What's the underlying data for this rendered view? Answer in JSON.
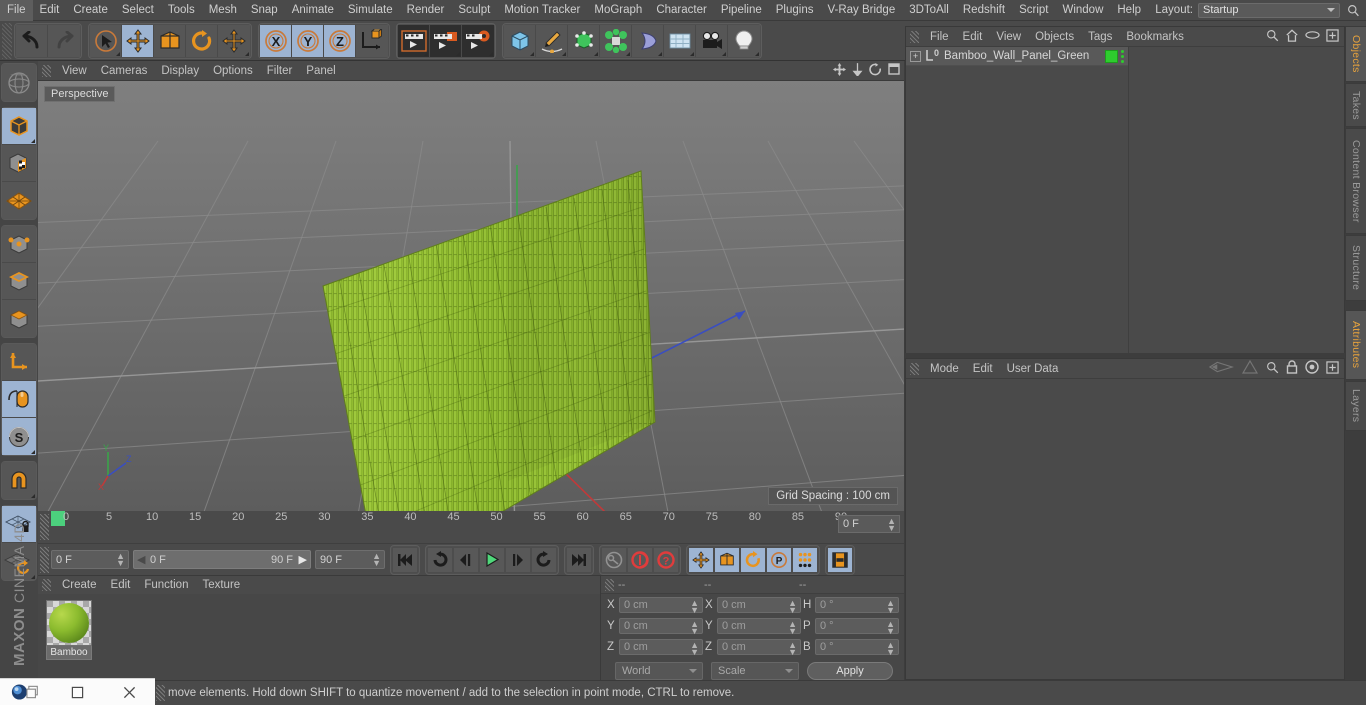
{
  "menubar": {
    "items": [
      "File",
      "Edit",
      "Create",
      "Select",
      "Tools",
      "Mesh",
      "Snap",
      "Animate",
      "Simulate",
      "Render",
      "Sculpt",
      "Motion Tracker",
      "MoGraph",
      "Character",
      "Pipeline",
      "Plugins",
      "V-Ray Bridge",
      "3DToAll",
      "Redshift",
      "Script",
      "Window",
      "Help"
    ],
    "layout_label": "Layout:",
    "layout_value": "Startup",
    "search_icon": "search-icon"
  },
  "toolbar": {
    "groups": [
      {
        "name": "undo-redo",
        "buttons": [
          {
            "name": "undo-button",
            "icon": "undo-arrow-icon",
            "state": "normal"
          },
          {
            "name": "redo-button",
            "icon": "redo-arrow-icon",
            "state": "disabled"
          }
        ]
      },
      {
        "name": "transform-tools",
        "buttons": [
          {
            "name": "select-tool-button",
            "icon": "cursor-select-icon",
            "state": "normal"
          },
          {
            "name": "move-tool-button",
            "icon": "move-arrows-icon",
            "state": "active"
          },
          {
            "name": "scale-tool-button",
            "icon": "scale-box-icon",
            "state": "normal"
          },
          {
            "name": "rotate-tool-button",
            "icon": "rotate-circle-icon",
            "state": "normal"
          },
          {
            "name": "free-move-tool-button",
            "icon": "move-arrows-icon",
            "state": "normal"
          }
        ]
      },
      {
        "name": "axis-locks",
        "buttons": [
          {
            "name": "lock-x-axis-button",
            "icon": "x-axis-icon",
            "state": "active",
            "label": "X"
          },
          {
            "name": "lock-y-axis-button",
            "icon": "y-axis-icon",
            "state": "active",
            "label": "Y"
          },
          {
            "name": "lock-z-axis-button",
            "icon": "z-axis-icon",
            "state": "active",
            "label": "Z"
          },
          {
            "name": "world-object-axis-button",
            "icon": "world-axis-cube-icon",
            "state": "normal"
          }
        ]
      },
      {
        "name": "render-group",
        "buttons": [
          {
            "name": "render-view-button",
            "icon": "render-clapper-icon",
            "state": "dark"
          },
          {
            "name": "render-to-picture-viewer-button",
            "icon": "render-picture-icon",
            "state": "dark"
          },
          {
            "name": "render-settings-button",
            "icon": "render-gear-icon",
            "state": "dark"
          }
        ]
      },
      {
        "name": "create-group",
        "buttons": [
          {
            "name": "add-cube-button",
            "icon": "blue-cube-icon",
            "state": "normal"
          },
          {
            "name": "add-spline-button",
            "icon": "pen-spline-icon",
            "state": "normal"
          },
          {
            "name": "add-generator-button",
            "icon": "green-cube-icon",
            "state": "normal"
          },
          {
            "name": "add-array-button",
            "icon": "green-cluster-icon",
            "state": "normal"
          },
          {
            "name": "add-deformer-button",
            "icon": "bend-deformer-icon",
            "state": "normal"
          },
          {
            "name": "add-environment-button",
            "icon": "floor-grid-icon",
            "state": "normal"
          },
          {
            "name": "add-camera-button",
            "icon": "camera-icon",
            "state": "normal"
          },
          {
            "name": "add-light-button",
            "icon": "light-bulb-icon",
            "state": "normal"
          }
        ]
      }
    ]
  },
  "left_tools": {
    "groups": [
      [
        {
          "name": "world-axis-tool",
          "icon": "globe-axis-icon",
          "state": "disabled"
        }
      ],
      [
        {
          "name": "model-mode-tool",
          "icon": "dark-cube-icon",
          "state": "active"
        },
        {
          "name": "texture-mode-tool",
          "icon": "checker-cube-icon",
          "state": "normal"
        },
        {
          "name": "uv-polygons-tool",
          "icon": "orange-mesh-icon",
          "state": "normal"
        }
      ],
      [
        {
          "name": "points-mode-tool",
          "icon": "points-cube-icon",
          "state": "normal"
        },
        {
          "name": "edges-mode-tool",
          "icon": "edges-cube-icon",
          "state": "normal"
        },
        {
          "name": "polygons-mode-tool",
          "icon": "polygon-cube-icon",
          "state": "normal"
        }
      ],
      [
        {
          "name": "object-axis-tool",
          "icon": "axis-corner-icon",
          "state": "normal"
        },
        {
          "name": "viewport-solo-tool",
          "icon": "mouse-icon",
          "state": "active"
        },
        {
          "name": "enable-axis-tool",
          "icon": "s-sphere-icon",
          "state": "active"
        }
      ],
      [
        {
          "name": "snap-tool",
          "icon": "magnet-icon",
          "state": "normal"
        }
      ],
      [
        {
          "name": "lock-workplane-tool",
          "icon": "grid-lock-icon",
          "state": "active"
        },
        {
          "name": "workplane-rotate-tool",
          "icon": "grid-rotate-icon",
          "state": "normal"
        }
      ]
    ],
    "brand_main": "MAXON",
    "brand_sub": "CINEMA 4D"
  },
  "viewport": {
    "menus": [
      "View",
      "Cameras",
      "Display",
      "Options",
      "Filter",
      "Panel"
    ],
    "label": "Perspective",
    "grid_spacing": "Grid Spacing : 100 cm",
    "axis_labels": {
      "x": "X",
      "y": "Y",
      "z": "Z"
    },
    "icons": [
      "viewport-pan-icon",
      "viewport-dolly-icon",
      "viewport-rotate-icon",
      "viewport-maximize-icon"
    ],
    "object_color": "#8cbb2c",
    "bg_top": "#7b7b7b",
    "bg_bottom": "#5f5f5f"
  },
  "timeline": {
    "ticks": [
      0,
      5,
      10,
      15,
      20,
      25,
      30,
      35,
      40,
      45,
      50,
      55,
      60,
      65,
      70,
      75,
      80,
      85,
      90
    ],
    "min": 0,
    "max": 90,
    "current_frame_field": "0 F"
  },
  "animbar": {
    "current_frame": "0 F",
    "range_start": "0 F",
    "range_end": "90 F",
    "doc_end": "90 F",
    "buttons": [
      {
        "name": "go-to-start-button",
        "icon": "skip-back-icon"
      },
      {
        "name": "play-backwards-button",
        "icon": "rewind-loop-icon"
      },
      {
        "name": "step-back-button",
        "icon": "step-back-icon"
      },
      {
        "name": "play-button",
        "icon": "play-triangle-icon"
      },
      {
        "name": "step-forward-button",
        "icon": "step-forward-icon"
      },
      {
        "name": "play-forward-loop-button",
        "icon": "forward-loop-icon"
      },
      {
        "name": "go-to-end-button",
        "icon": "skip-forward-icon"
      },
      {
        "name": "record-active-objects-button",
        "icon": "key-icon"
      },
      {
        "name": "autokeying-button",
        "icon": "red-circle-icon"
      },
      {
        "name": "keyframe-selection-button",
        "icon": "red-question-icon"
      },
      {
        "name": "position-key-button",
        "icon": "move-arrows-icon"
      },
      {
        "name": "scale-key-button",
        "icon": "scale-box-icon"
      },
      {
        "name": "rotation-key-button",
        "icon": "rotate-circle-icon"
      },
      {
        "name": "parameter-key-button",
        "icon": "p-circle-icon"
      },
      {
        "name": "point-level-animation-button",
        "icon": "dot-grid-icon"
      },
      {
        "name": "timeline-toggle-button",
        "icon": "film-strip-icon"
      }
    ]
  },
  "material_manager": {
    "menus": [
      "Create",
      "Edit",
      "Function",
      "Texture"
    ],
    "materials": [
      {
        "name": "Bamboo",
        "color": "#8cbb2c"
      }
    ]
  },
  "coordinates": {
    "header": [
      "--",
      "--",
      "--"
    ],
    "rows": [
      {
        "label1": "X",
        "value1": "0 cm",
        "label2": "X",
        "value2": "0 cm",
        "label3": "H",
        "value3": "0 °"
      },
      {
        "label1": "Y",
        "value1": "0 cm",
        "label2": "Y",
        "value2": "0 cm",
        "label3": "P",
        "value3": "0 °"
      },
      {
        "label1": "Z",
        "value1": "0 cm",
        "label2": "Z",
        "value2": "0 cm",
        "label3": "B",
        "value3": "0 °"
      }
    ],
    "system": "World",
    "mode": "Scale",
    "apply_label": "Apply"
  },
  "object_manager": {
    "menus": [
      "File",
      "Edit",
      "View",
      "Objects",
      "Tags",
      "Bookmarks"
    ],
    "icons": [
      "search-icon",
      "home-icon",
      "eye-icon",
      "plus-box-icon"
    ],
    "objects": [
      {
        "name": "Bamboo_Wall_Panel_Green",
        "type": "null-object",
        "tag_color": "#2ecc2e",
        "expandable": true
      }
    ]
  },
  "attribute_manager": {
    "menus": [
      "Mode",
      "Edit",
      "User Data"
    ],
    "icons": [
      "layer-back-icon",
      "layer-forward-icon",
      "search-icon",
      "lock-icon",
      "target-icon",
      "plus-box-icon"
    ]
  },
  "right_tabs": {
    "top": [
      {
        "label": "Objects",
        "active": true
      },
      {
        "label": "Takes",
        "active": false
      },
      {
        "label": "Content Browser",
        "active": false
      },
      {
        "label": "Structure",
        "active": false
      }
    ],
    "bottom": [
      {
        "label": "Attributes",
        "active": true
      },
      {
        "label": "Layers",
        "active": false
      }
    ]
  },
  "statusbar": {
    "text": "move elements. Hold down SHIFT to quantize movement / add to the selection in point mode, CTRL to remove."
  },
  "taskbar": {
    "items": [
      {
        "name": "app-icon",
        "icon": "cinema4d-logo-icon"
      },
      {
        "name": "window-restore-button",
        "icon": "square-icon"
      },
      {
        "name": "window-close-button",
        "icon": "close-x-icon"
      }
    ]
  }
}
